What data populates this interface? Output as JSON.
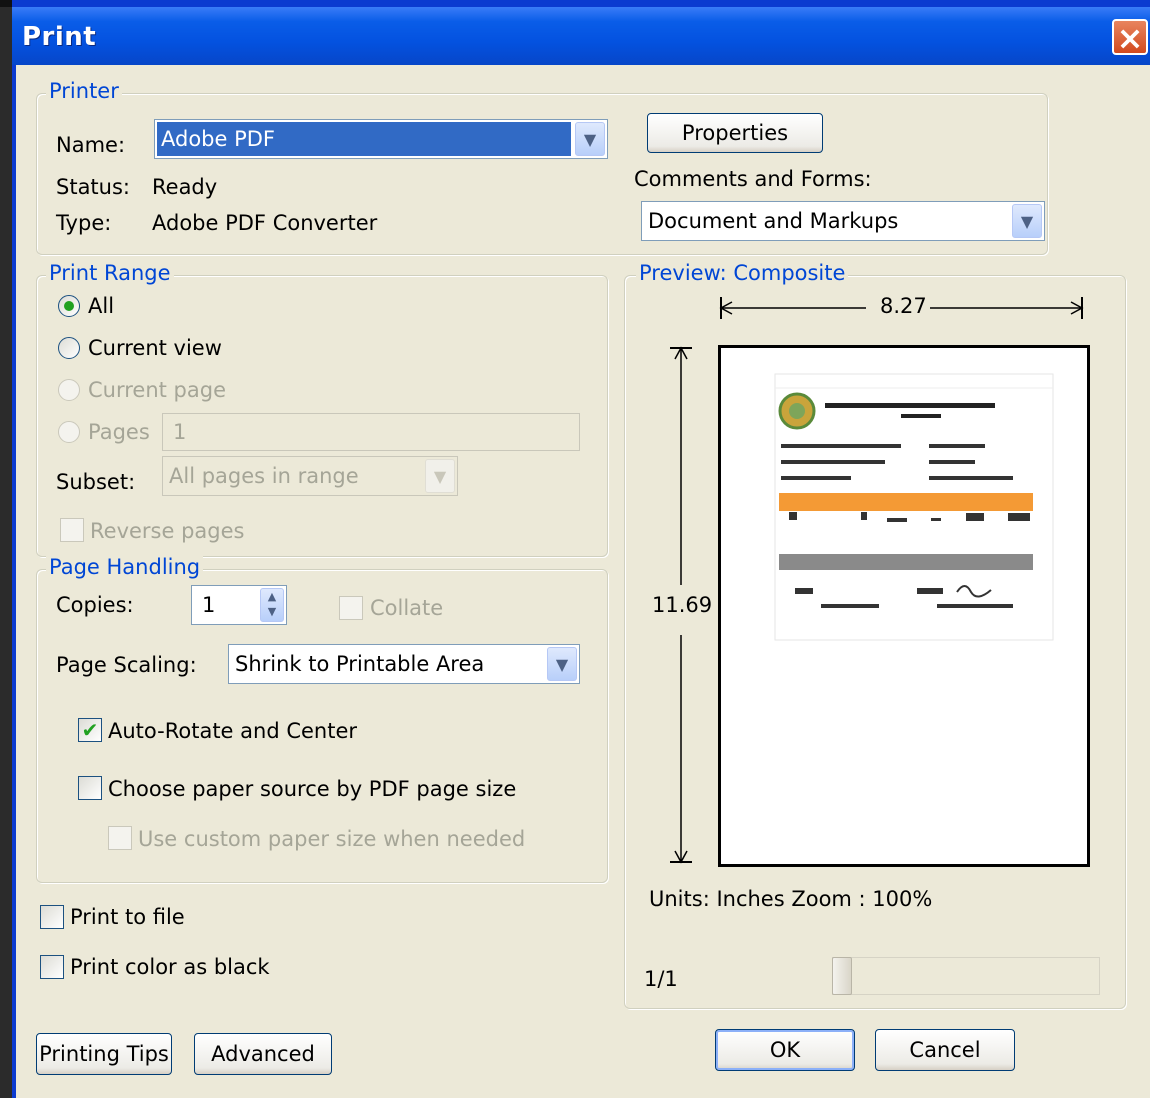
{
  "dialog": {
    "title": "Print"
  },
  "printer": {
    "group_label": "Printer",
    "name_label": "Name:",
    "name_value": "Adobe PDF",
    "status_label": "Status:",
    "status_value": "Ready",
    "type_label": "Type:",
    "type_value": "Adobe PDF Converter",
    "properties_button": "Properties",
    "comments_label": "Comments and Forms:",
    "comments_value": "Document and Markups"
  },
  "print_range": {
    "group_label": "Print Range",
    "all_label": "All",
    "all_selected": true,
    "current_view_label": "Current view",
    "current_page_label": "Current page",
    "pages_label": "Pages",
    "pages_value": "1",
    "subset_label": "Subset:",
    "subset_value": "All pages in range",
    "reverse_label": "Reverse pages"
  },
  "page_handling": {
    "group_label": "Page Handling",
    "copies_label": "Copies:",
    "copies_value": "1",
    "collate_label": "Collate",
    "scaling_label": "Page Scaling:",
    "scaling_value": "Shrink to Printable Area",
    "auto_rotate_label": "Auto-Rotate and Center",
    "auto_rotate_checked": true,
    "paper_source_label": "Choose paper source by PDF page size",
    "custom_paper_label": "Use custom paper size when needed"
  },
  "options": {
    "print_to_file_label": "Print to file",
    "print_black_label": "Print color as black"
  },
  "preview": {
    "group_label": "Preview: Composite",
    "width_value": "8.27",
    "height_value": "11.69",
    "units_text": "Units: Inches Zoom : 100%",
    "page_counter": "1/1"
  },
  "buttons": {
    "tips": "Printing Tips",
    "advanced": "Advanced",
    "ok": "OK",
    "cancel": "Cancel"
  },
  "icons": {
    "close": "close-icon",
    "dropdown": "chevron-down-icon",
    "spinner": "spinner-icon"
  },
  "colors": {
    "titlebar": "#0452e0",
    "group_label": "#0046d5",
    "dialog_bg": "#ece9d8",
    "selection": "#316ac5",
    "check": "#21a121"
  }
}
